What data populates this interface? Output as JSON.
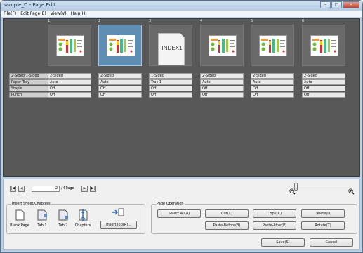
{
  "window": {
    "title": "sample_D - Page Edit"
  },
  "menu": [
    "File(F)",
    "Edit Page(E)",
    "View(V)",
    "Help(H)"
  ],
  "row_labels": [
    "2-Sided/1-Sided",
    "Paper Tray",
    "Staple",
    "Punch"
  ],
  "pages": [
    {
      "num": "1",
      "type": "doc",
      "props": [
        "2-Sided",
        "Auto",
        "Off",
        "Off"
      ]
    },
    {
      "num": "2",
      "type": "doc",
      "selected": true,
      "props": [
        "2-Sided",
        "Auto",
        "Off",
        "Off"
      ]
    },
    {
      "num": "3",
      "type": "index",
      "index_label": "INDEX1",
      "props": [
        "1-Sided",
        "Tray 1",
        "Off",
        "Off"
      ]
    },
    {
      "num": "4",
      "type": "doc",
      "props": [
        "2-Sided",
        "Auto",
        "Off",
        "Off"
      ]
    },
    {
      "num": "5",
      "type": "doc",
      "props": [
        "2-Sided",
        "Auto",
        "Off",
        "Off"
      ]
    },
    {
      "num": "6",
      "type": "doc",
      "props": [
        "2-Sided",
        "Auto",
        "Off",
        "Off"
      ]
    }
  ],
  "nav": {
    "current": "2",
    "total": "/ 6Page"
  },
  "insert": {
    "title": "Insert Sheet/Chapters",
    "blank": "Blank Page",
    "tab1": "Tab 1",
    "tab2": "Tab 2",
    "chapters": "Chapters",
    "insert_job": "Insert Job(R)..."
  },
  "pageop": {
    "title": "Page Operation",
    "select_all": "Select All(A)",
    "cut": "Cut(X)",
    "copy": "Copy(C)",
    "delete": "Delete(D)",
    "paste_before": "Paste-Before(B)",
    "paste_after": "Paste-After(P)",
    "rotate": "Rotate(T)"
  },
  "footer": {
    "save": "Save(S)",
    "cancel": "Cancel"
  },
  "colors": {
    "canvas": "#585858",
    "selected": "#5e8eb3"
  }
}
